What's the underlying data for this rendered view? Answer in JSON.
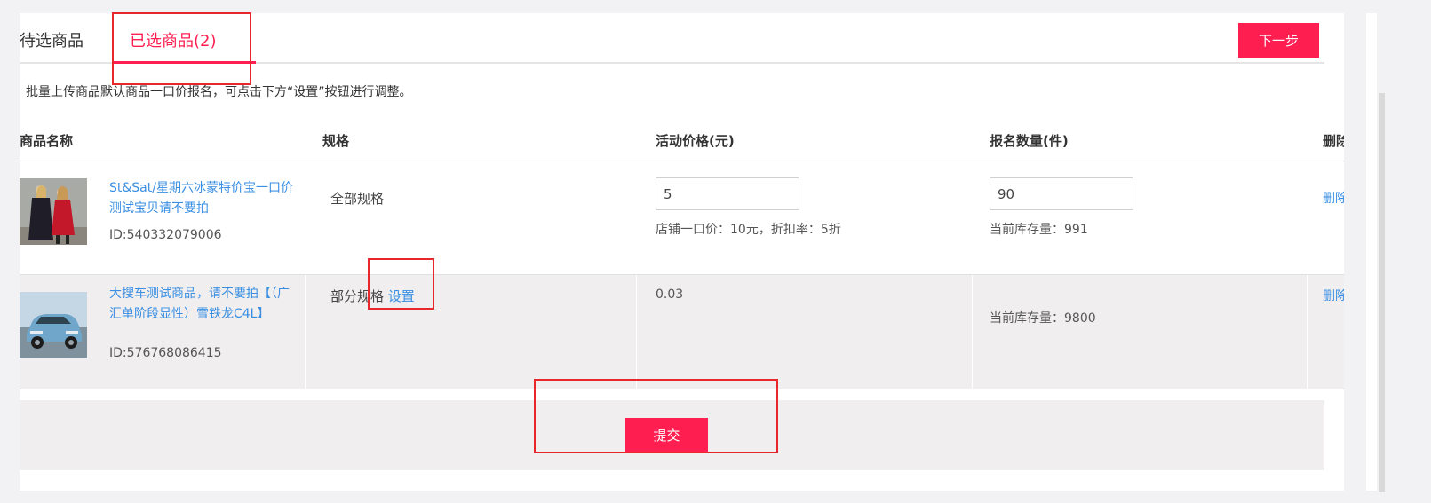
{
  "tabs": {
    "pending_label": "待选商品",
    "selected_label": "已选商品(2)",
    "next_button": "下一步"
  },
  "notice": "批量上传商品默认商品一口价报名，可点击下方“设置”按钮进行调整。",
  "table": {
    "headers": {
      "name": "商品名称",
      "spec": "规格",
      "price": "活动价格(元)",
      "quantity": "报名数量(件)",
      "delete": "删除"
    },
    "rows": [
      {
        "name": "St&Sat/星期六冰蒙特价宝一口价测试宝贝请不要拍",
        "id": "ID:540332079006",
        "spec": "全部规格",
        "price_value": "5",
        "price_note": "店铺一口价：10元，折扣率：5折",
        "quantity_value": "90",
        "stock_note": "当前库存量：991",
        "delete": "删除"
      },
      {
        "name": "大搜车测试商品，请不要拍【（广汇单阶段显性）雪铁龙C4L】",
        "id": "ID:576768086415",
        "spec": "部分规格",
        "spec_link": "设置",
        "price_text": "0.03",
        "stock_note": "当前库存量：9800",
        "delete": "删除"
      }
    ]
  },
  "footer": {
    "submit_button": "提交"
  },
  "colors": {
    "accent": "#ff1e50",
    "link": "#3a8fe3",
    "highlight_box": "#e8262c"
  }
}
